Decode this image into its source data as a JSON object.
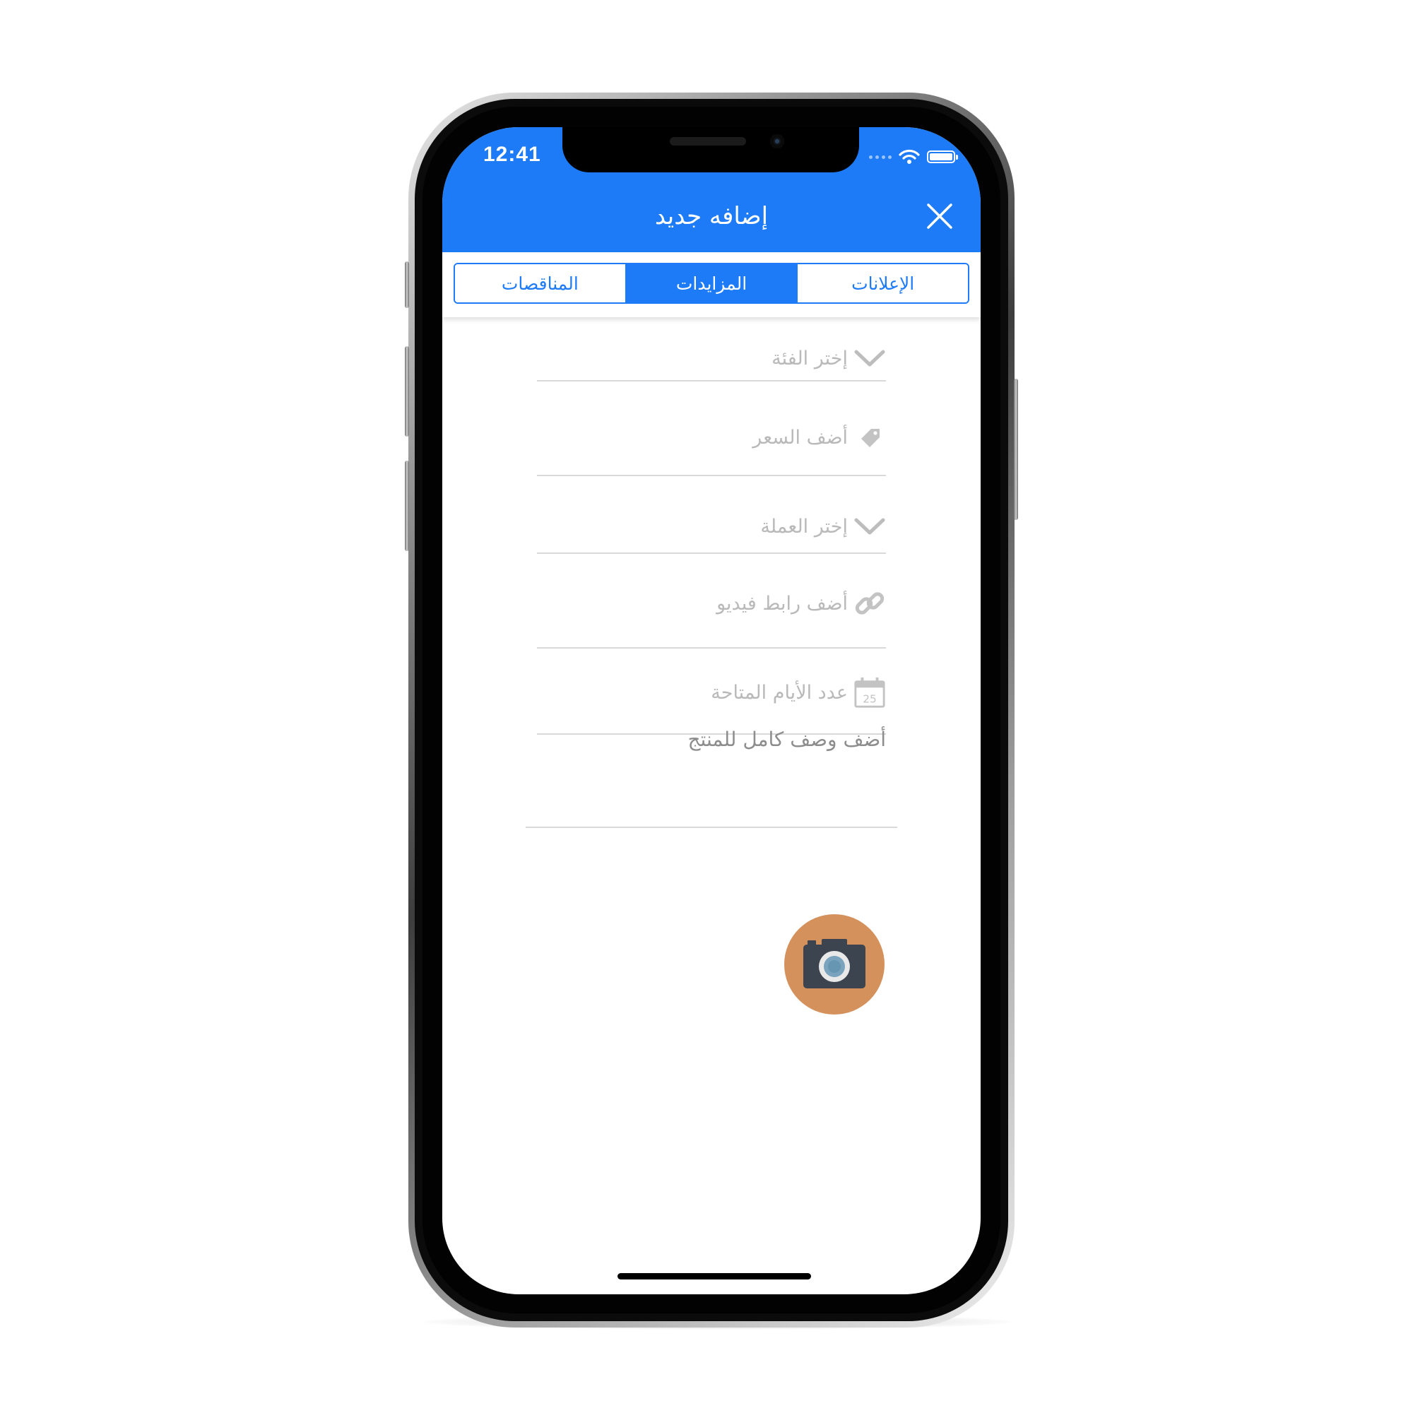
{
  "status_bar": {
    "time": "12:41"
  },
  "header": {
    "title": "إضافه جديد"
  },
  "tabs": [
    {
      "label": "المناقصات",
      "active": false
    },
    {
      "label": "المزايدات",
      "active": true
    },
    {
      "label": "الإعلانات",
      "active": false
    }
  ],
  "form": {
    "category_placeholder": "إختر الفئة",
    "price_placeholder": "أضف السعر",
    "currency_placeholder": "إختر العملة",
    "video_link_placeholder": "أضف رابط فيديو",
    "days_placeholder": "عدد الأيام المتاحة",
    "calendar_day": "25",
    "description_placeholder": "أضف وصف كامل للمنتج"
  },
  "colors": {
    "accent": "#1d7bf7",
    "camera_button": "#d4915c",
    "placeholder_text": "#b9b9b9"
  },
  "icons": [
    "close-icon",
    "chevron-down-icon",
    "price-tag-icon",
    "link-icon",
    "calendar-icon",
    "camera-icon",
    "wifi-icon",
    "battery-icon"
  ]
}
